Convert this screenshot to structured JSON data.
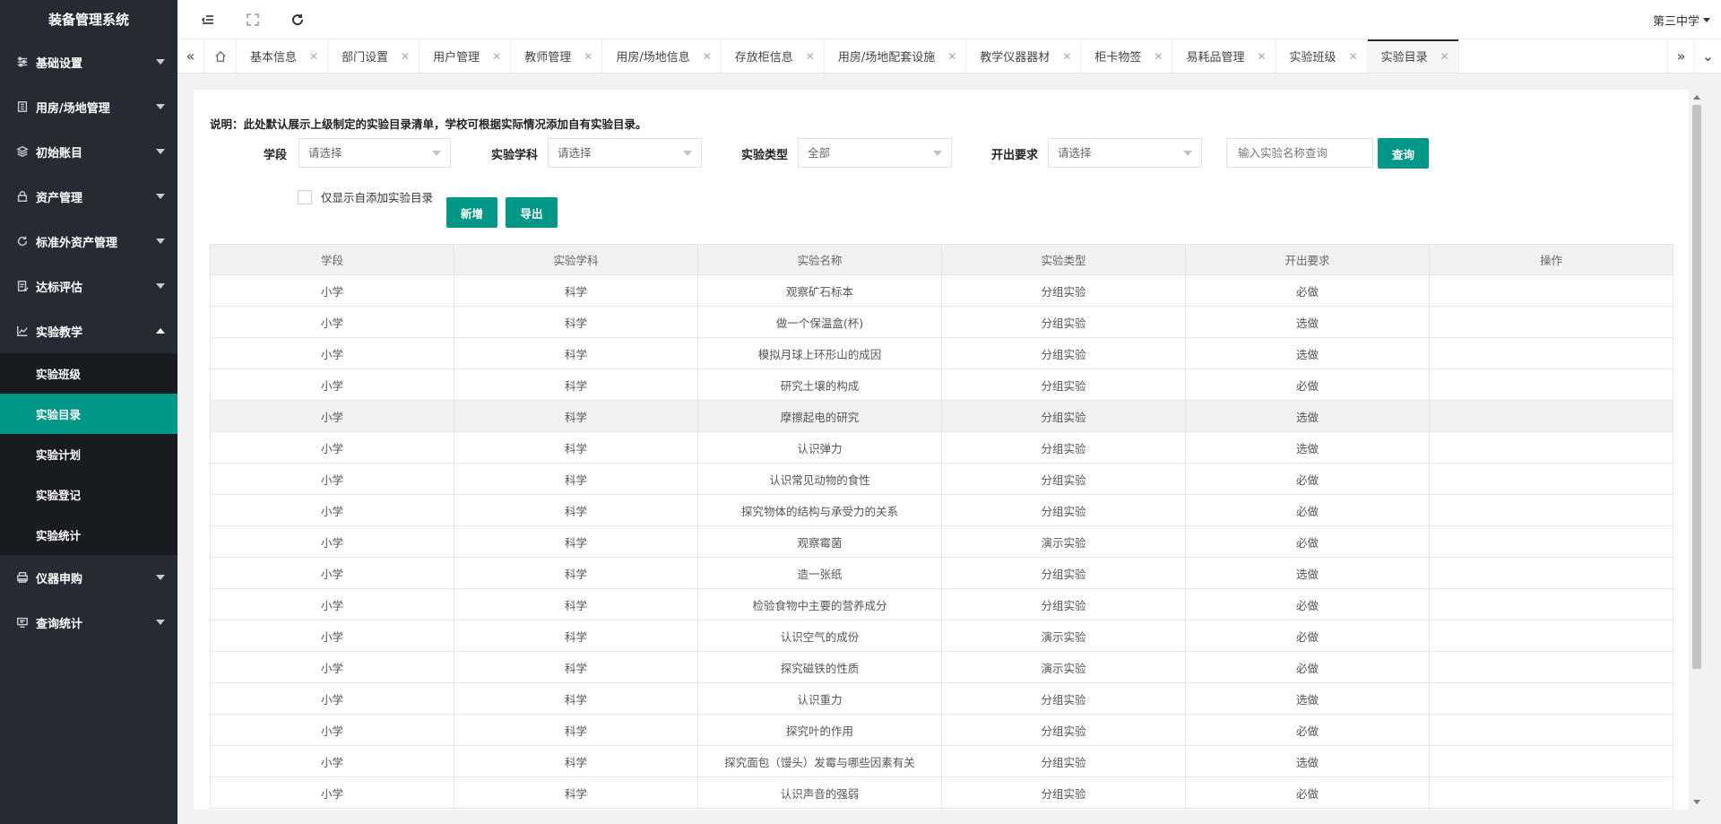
{
  "app": {
    "title": "装备管理系统",
    "school": "第三中学"
  },
  "sidebar": {
    "items": [
      {
        "label": "基础设置",
        "icon": "sliders-icon"
      },
      {
        "label": "用房/场地管理",
        "icon": "building-icon"
      },
      {
        "label": "初始账目",
        "icon": "layers-icon"
      },
      {
        "label": "资产管理",
        "icon": "lock-icon"
      },
      {
        "label": "标准外资产管理",
        "icon": "refresh-icon"
      },
      {
        "label": "达标评估",
        "icon": "checklist-icon"
      },
      {
        "label": "实验教学",
        "icon": "chart-icon",
        "expanded": true
      }
    ],
    "submenu": [
      {
        "label": "实验班级"
      },
      {
        "label": "实验目录",
        "active": true
      },
      {
        "label": "实验计划"
      },
      {
        "label": "实验登记"
      },
      {
        "label": "实验统计"
      }
    ],
    "items_after": [
      {
        "label": "仪器申购",
        "icon": "printer-icon"
      },
      {
        "label": "查询统计",
        "icon": "monitor-icon"
      }
    ]
  },
  "tabs": [
    {
      "label": "基本信息"
    },
    {
      "label": "部门设置"
    },
    {
      "label": "用户管理"
    },
    {
      "label": "教师管理"
    },
    {
      "label": "用房/场地信息"
    },
    {
      "label": "存放柜信息"
    },
    {
      "label": "用房/场地配套设施"
    },
    {
      "label": "教学仪器器材"
    },
    {
      "label": "柜卡物签"
    },
    {
      "label": "易耗品管理"
    },
    {
      "label": "实验班级"
    },
    {
      "label": "实验目录",
      "active": true
    }
  ],
  "content": {
    "notice": "说明：此处默认展示上级制定的实验目录清单，学校可根据实际情况添加自有实验目录。",
    "filters": {
      "stage_label": "学段",
      "stage_value": "请选择",
      "subject_label": "实验学科",
      "subject_value": "请选择",
      "type_label": "实验类型",
      "type_value": "全部",
      "req_label": "开出要求",
      "req_value": "请选择",
      "search_placeholder": "输入实验名称查询",
      "search_button": "查询"
    },
    "checkbox_label": "仅显示自添加实验目录",
    "add_button": "新增",
    "export_button": "导出"
  },
  "table": {
    "headers": [
      "学段",
      "实验学科",
      "实验名称",
      "实验类型",
      "开出要求",
      "操作"
    ],
    "rows": [
      [
        "小学",
        "科学",
        "观察矿石标本",
        "分组实验",
        "必做",
        ""
      ],
      [
        "小学",
        "科学",
        "做一个保温盒(杯)",
        "分组实验",
        "选做",
        ""
      ],
      [
        "小学",
        "科学",
        "模拟月球上环形山的成因",
        "分组实验",
        "选做",
        ""
      ],
      [
        "小学",
        "科学",
        "研究土壤的构成",
        "分组实验",
        "必做",
        ""
      ],
      [
        "小学",
        "科学",
        "摩擦起电的研究",
        "分组实验",
        "选做",
        ""
      ],
      [
        "小学",
        "科学",
        "认识弹力",
        "分组实验",
        "选做",
        ""
      ],
      [
        "小学",
        "科学",
        "认识常见动物的食性",
        "分组实验",
        "必做",
        ""
      ],
      [
        "小学",
        "科学",
        "探究物体的结构与承受力的关系",
        "分组实验",
        "必做",
        ""
      ],
      [
        "小学",
        "科学",
        "观察霉菌",
        "演示实验",
        "必做",
        ""
      ],
      [
        "小学",
        "科学",
        "造一张纸",
        "分组实验",
        "选做",
        ""
      ],
      [
        "小学",
        "科学",
        "检验食物中主要的营养成分",
        "分组实验",
        "必做",
        ""
      ],
      [
        "小学",
        "科学",
        "认识空气的成份",
        "演示实验",
        "必做",
        ""
      ],
      [
        "小学",
        "科学",
        "探究磁铁的性质",
        "演示实验",
        "必做",
        ""
      ],
      [
        "小学",
        "科学",
        "认识重力",
        "分组实验",
        "选做",
        ""
      ],
      [
        "小学",
        "科学",
        "探究叶的作用",
        "分组实验",
        "必做",
        ""
      ],
      [
        "小学",
        "科学",
        "探究面包（馒头）发霉与哪些因素有关",
        "分组实验",
        "选做",
        ""
      ],
      [
        "小学",
        "科学",
        "认识声音的强弱",
        "分组实验",
        "必做",
        ""
      ]
    ]
  }
}
